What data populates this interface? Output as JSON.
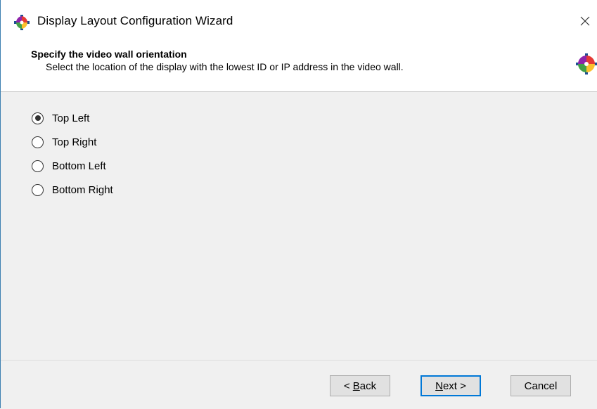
{
  "window": {
    "title": "Display Layout Configuration Wizard",
    "app_icon": "color-wheel-icon",
    "close_icon": "close-icon"
  },
  "header": {
    "title": "Specify the video wall orientation",
    "subtitle": "Select the location of the display with the lowest ID or IP address in the video wall.",
    "icon": "color-wheel-icon"
  },
  "orientation": {
    "selected": "Top Left",
    "options": [
      {
        "label": "Top Left",
        "checked": true
      },
      {
        "label": "Top Right",
        "checked": false
      },
      {
        "label": "Bottom Left",
        "checked": false
      },
      {
        "label": "Bottom Right",
        "checked": false
      }
    ]
  },
  "footer": {
    "back_mnemonic": "B",
    "back_rest": "ack",
    "back_prefix": "< ",
    "next_mnemonic": "N",
    "next_rest": "ext >",
    "cancel_label": "Cancel"
  },
  "colors": {
    "accent": "#0078d7",
    "window_border": "#3c7fb1",
    "panel_bg": "#f0f0f0"
  }
}
